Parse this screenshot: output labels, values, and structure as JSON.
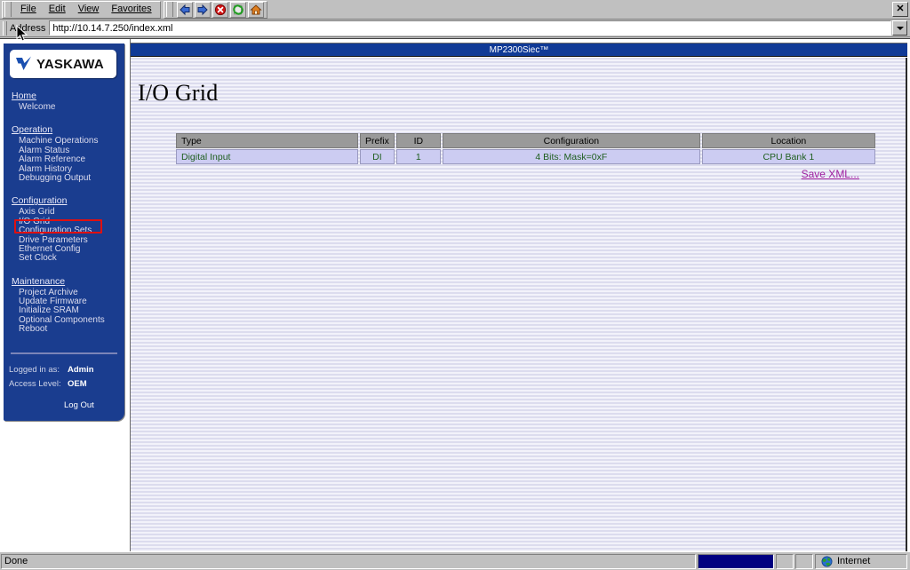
{
  "browser": {
    "menu_items": [
      "File",
      "Edit",
      "View",
      "Favorites"
    ],
    "toolbar_buttons": [
      {
        "name": "back-button",
        "icon": "back-arrow-icon"
      },
      {
        "name": "forward-button",
        "icon": "forward-arrow-icon"
      },
      {
        "name": "stop-button",
        "icon": "stop-icon"
      },
      {
        "name": "refresh-button",
        "icon": "refresh-icon"
      },
      {
        "name": "home-button",
        "icon": "home-icon"
      }
    ],
    "close_label": "✕",
    "address_label": "Address",
    "address_value": "http://10.14.7.250/index.xml",
    "address_placeholder": "http://"
  },
  "sidebar": {
    "logo_text": "YASKAWA",
    "sections": [
      {
        "heading": "Home",
        "links": [
          "Welcome"
        ]
      },
      {
        "heading": "Operation",
        "links": [
          "Machine Operations",
          "Alarm Status",
          "Alarm Reference",
          "Alarm History",
          "Debugging Output"
        ]
      },
      {
        "heading": "Configuration",
        "links": [
          "Axis Grid",
          "I/O Grid",
          "Configuration Sets",
          "Drive Parameters",
          "Ethernet Config",
          "Set Clock"
        ]
      },
      {
        "heading": "Maintenance",
        "links": [
          "Project Archive",
          "Update Firmware",
          "Initialize SRAM",
          "Optional Components",
          "Reboot"
        ]
      }
    ],
    "login": {
      "logged_in_label": "Logged in as:",
      "logged_in_value": "Admin",
      "access_level_label": "Access Level:",
      "access_level_value": "OEM",
      "logout_label": "Log Out"
    }
  },
  "content": {
    "device_title": "MP2300Siec™",
    "page_title": "I/O Grid",
    "table": {
      "headers": [
        "Type",
        "Prefix",
        "ID",
        "Configuration",
        "Location"
      ],
      "rows": [
        [
          "Digital Input",
          "DI",
          "1",
          "4 Bits: Mask=0xF",
          "CPU Bank 1"
        ]
      ]
    },
    "save_xml_label": "Save XML..."
  },
  "statusbar": {
    "status_text": "Done",
    "zone_label": "Internet"
  },
  "colors": {
    "nav_blue": "#1a3d8f",
    "title_blue": "#103a96",
    "header_gray": "#9a9a9a",
    "row_lavender": "#ccccf2",
    "row_text_green": "#1e5e1e",
    "link_purple": "#a020a0",
    "annotation_red": "#e01010"
  }
}
